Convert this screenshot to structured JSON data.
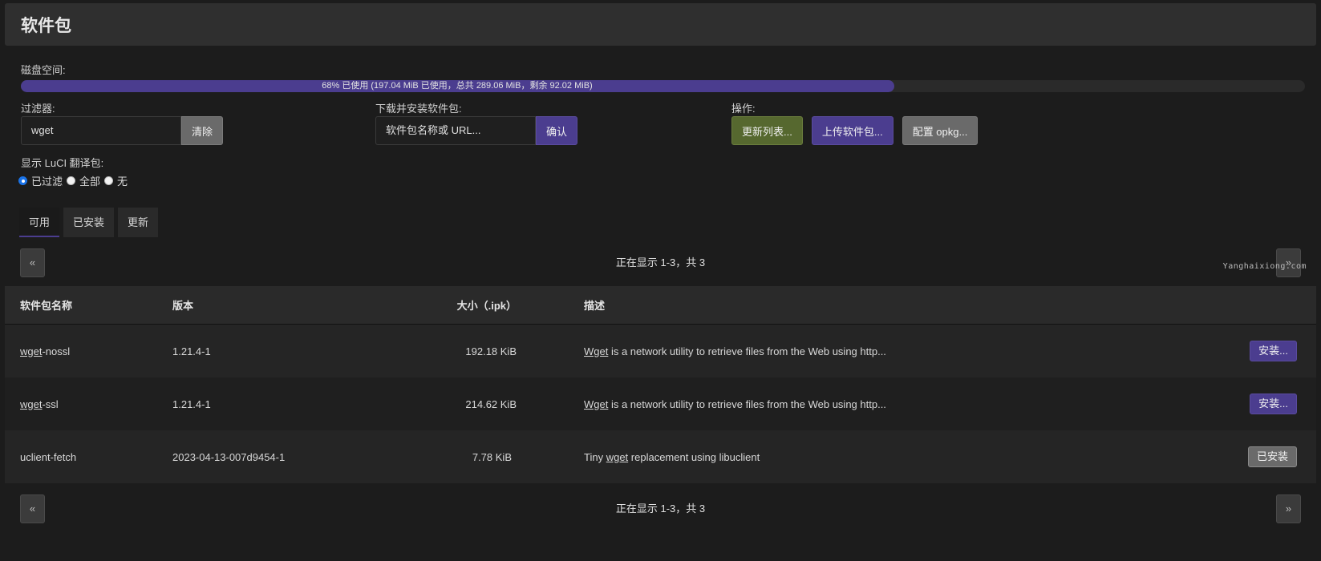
{
  "page": {
    "title": "软件包"
  },
  "disk": {
    "label": "磁盘空间:",
    "usage_percent": 68,
    "usage_text": "68% 已使用 (197.04 MiB 已使用，总共 289.06 MiB，剩余 92.02 MiB)"
  },
  "filter": {
    "label": "过滤器:",
    "value": "wget",
    "clear_label": "清除"
  },
  "download": {
    "label": "下载并安装软件包:",
    "placeholder": "软件包名称或 URL...",
    "confirm_label": "确认"
  },
  "actions": {
    "label": "操作:",
    "update_lists_label": "更新列表...",
    "upload_label": "上传软件包...",
    "configure_label": "配置 opkg..."
  },
  "luci_translation": {
    "label": "显示 LuCI 翻译包:",
    "options": [
      "已过滤",
      "全部",
      "无"
    ],
    "selected": "已过滤"
  },
  "tabs": [
    {
      "label": "可用",
      "active": true
    },
    {
      "label": "已安装",
      "active": false
    },
    {
      "label": "更新",
      "active": false
    }
  ],
  "pager": {
    "prev_label": "«",
    "next_label": "»",
    "status": "正在显示 1-3，共 3"
  },
  "watermark": "Yanghaixiong.com",
  "table": {
    "headers": [
      "软件包名称",
      "版本",
      "大小（.ipk）",
      "描述"
    ],
    "rows": [
      {
        "name_link": "wget",
        "name_rest": "-nossl",
        "version": "1.21.4-1",
        "size": "192.18 KiB",
        "desc_link": "Wget",
        "desc_rest": " is a network utility to retrieve files from the Web using http...",
        "action": "安装...",
        "action_type": "install"
      },
      {
        "name_link": "wget",
        "name_rest": "-ssl",
        "version": "1.21.4-1",
        "size": "214.62 KiB",
        "desc_link": "Wget",
        "desc_rest": " is a network utility to retrieve files from the Web using http...",
        "action": "安装...",
        "action_type": "install"
      },
      {
        "name_link": "",
        "name_rest": "uclient-fetch",
        "version": "2023-04-13-007d9454-1",
        "size": "7.78 KiB",
        "desc_pre": "Tiny ",
        "desc_link": "wget",
        "desc_rest": " replacement using libuclient",
        "action": "已安装",
        "action_type": "installed"
      }
    ]
  },
  "colors": {
    "accent_purple": "#4b3d8f",
    "accent_green": "#56682f",
    "button_gray": "#6a6a6a",
    "background": "#1c1c1c"
  }
}
